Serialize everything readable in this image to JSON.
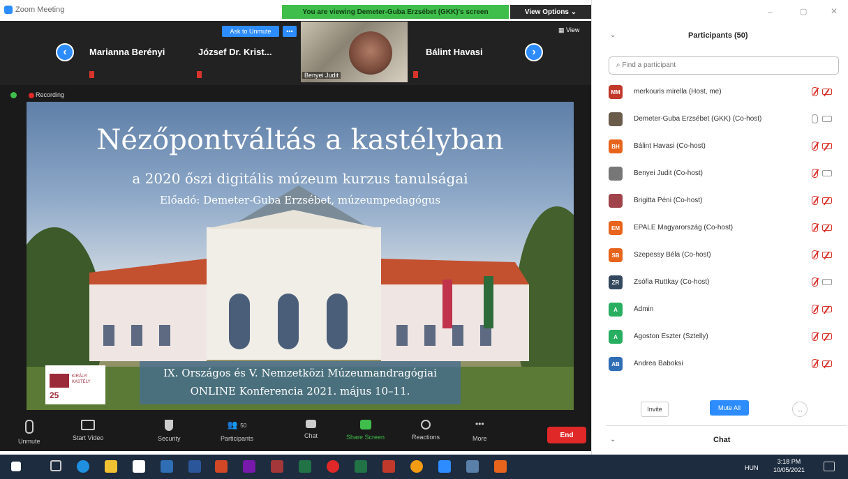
{
  "window": {
    "title": "Zoom Meeting"
  },
  "share_banner": "You are viewing Demeter-Guba Erzsébet (GKK)'s screen",
  "view_options": "View Options ⌄",
  "strip": {
    "tiles": [
      "Marianna Berényi",
      "József Dr. Krist...",
      "Bálint Havasi"
    ],
    "ask_to_unmute": "Ask to Unmute",
    "video_name": "Benyei Judit",
    "view_label": "View"
  },
  "recording": "Recording",
  "slide": {
    "title": "Nézőpontváltás a kastélyban",
    "subtitle": "a 2020 őszi digitális múzeum kurzus tanulságai",
    "presenter": "Előadó: Demeter-Guba Erzsébet, múzeumpedagógus",
    "conference_line1": "IX. Országos és V. Nemzetközi Múzeumandragógiai",
    "conference_line2": "ONLINE Konferencia 2021. május 10–11.",
    "logo_text": "KIRÁLYI KASTÉLY",
    "logo_number": "25"
  },
  "toolbar": {
    "unmute": "Unmute",
    "start_video": "Start Video",
    "security": "Security",
    "participants": "Participants",
    "participants_count": "50",
    "chat": "Chat",
    "share_screen": "Share Screen",
    "reactions": "Reactions",
    "more": "More",
    "end": "End"
  },
  "panel": {
    "title": "Participants (50)",
    "search_placeholder": "Find a participant",
    "participants": [
      {
        "initials": "MM",
        "color": "#c0392b",
        "name": "merkouris mirella (Host, me)",
        "mic": "muted",
        "cam": "off"
      },
      {
        "initials": "",
        "color": "#6b5b4b",
        "name": "Demeter-Guba Erzsébet (GKK) (Co-host)",
        "mic": "on",
        "cam": "on"
      },
      {
        "initials": "BH",
        "color": "#e8641c",
        "name": "Bálint Havasi (Co-host)",
        "mic": "muted",
        "cam": "off"
      },
      {
        "initials": "",
        "color": "#777",
        "name": "Benyei Judit (Co-host)",
        "mic": "muted",
        "cam": "on"
      },
      {
        "initials": "",
        "color": "#a0434b",
        "name": "Brigitta Péni (Co-host)",
        "mic": "muted",
        "cam": "off"
      },
      {
        "initials": "EM",
        "color": "#e8641c",
        "name": "EPALE Magyarország (Co-host)",
        "mic": "muted",
        "cam": "off"
      },
      {
        "initials": "SB",
        "color": "#e8641c",
        "name": "Szepessy Béla (Co-host)",
        "mic": "muted",
        "cam": "off"
      },
      {
        "initials": "ZR",
        "color": "#34495e",
        "name": "Zsófia Ruttkay (Co-host)",
        "mic": "muted",
        "cam": "on"
      },
      {
        "initials": "A",
        "color": "#27ae60",
        "name": "Admin",
        "mic": "muted",
        "cam": "off"
      },
      {
        "initials": "A",
        "color": "#27ae60",
        "name": "Agoston Eszter (Sztelly)",
        "mic": "muted",
        "cam": "off"
      },
      {
        "initials": "AB",
        "color": "#2f6eb5",
        "name": "Andrea Baboksi",
        "mic": "muted",
        "cam": "off"
      }
    ],
    "invite": "Invite",
    "mute_all": "Mute All",
    "more": "...",
    "chat_title": "Chat"
  },
  "taskbar": {
    "lang": "HUN",
    "time": "3:18 PM",
    "date": "10/05/2021"
  }
}
